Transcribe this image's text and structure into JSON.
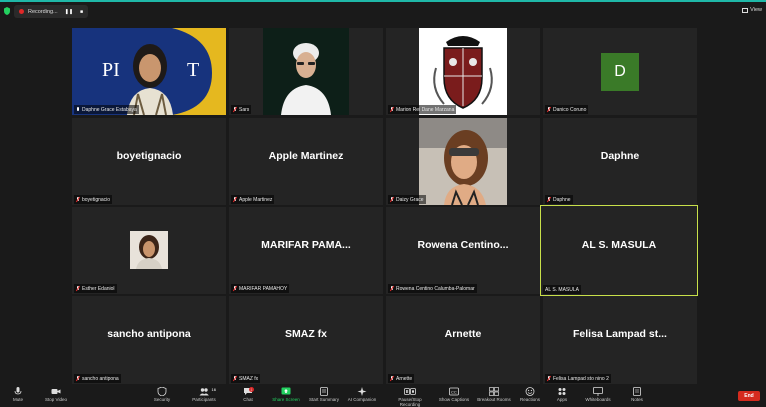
{
  "topbar": {
    "recording_label": "Recording...",
    "pause_label": "❚❚",
    "stop_label": "■",
    "view_label": "View"
  },
  "tiles": [
    {
      "big": "",
      "name": "Daphne Grace Estabaya",
      "muted": false
    },
    {
      "big": "",
      "name": "Sars",
      "muted": true
    },
    {
      "big": "",
      "name": "Marion Rei Dane Marzana",
      "muted": true
    },
    {
      "big": "",
      "name": "Danico Coruno",
      "muted": true
    },
    {
      "big": "boyetignacio",
      "name": "boyetignacio",
      "muted": true
    },
    {
      "big": "Apple Martinez",
      "name": "Apple Martinez",
      "muted": true
    },
    {
      "big": "",
      "name": "Daizy Grace",
      "muted": true
    },
    {
      "big": "Daphne",
      "name": "Daphne",
      "muted": true
    },
    {
      "big": "",
      "name": "Esther Edaniol",
      "muted": true
    },
    {
      "big": "MARIFAR  PAMA...",
      "name": "MARIFAR PAMAHOY",
      "muted": true
    },
    {
      "big": "Rowena  Centino...",
      "name": "Rowena Centino Calumba-Palomar",
      "muted": true
    },
    {
      "big": "AL S. MASULA",
      "name": "AL S. MASULA",
      "muted": false
    },
    {
      "big": "sancho antipona",
      "name": "sancho antipona",
      "muted": true
    },
    {
      "big": "SMAZ fx",
      "name": "SMAZ fx",
      "muted": true
    },
    {
      "big": "Arnette",
      "name": "Arnette",
      "muted": true
    },
    {
      "big": "Felisa  Lampad  st...",
      "name": "Felisa Lampad sto nino 2",
      "muted": true
    }
  ],
  "avatar_letter": "D",
  "avatar_color": "#3a7a28",
  "active_border_color": "#c8e04a",
  "toolbar": {
    "mute": "Mute",
    "stop_video": "Stop Video",
    "security": "Security",
    "participants": "Participants",
    "participants_count": "16",
    "chat": "Chat",
    "chat_badge": "1",
    "share_screen": "Share Screen",
    "start_summary": "Start Summary",
    "ai_companion": "AI Companion",
    "pause_recording": "Pause/Stop Recording",
    "show_captions": "Show Captions",
    "breakout_rooms": "Breakout Rooms",
    "reactions": "Reactions",
    "apps": "Apps",
    "whiteboards": "Whiteboards",
    "notes": "Notes",
    "end": "End"
  }
}
